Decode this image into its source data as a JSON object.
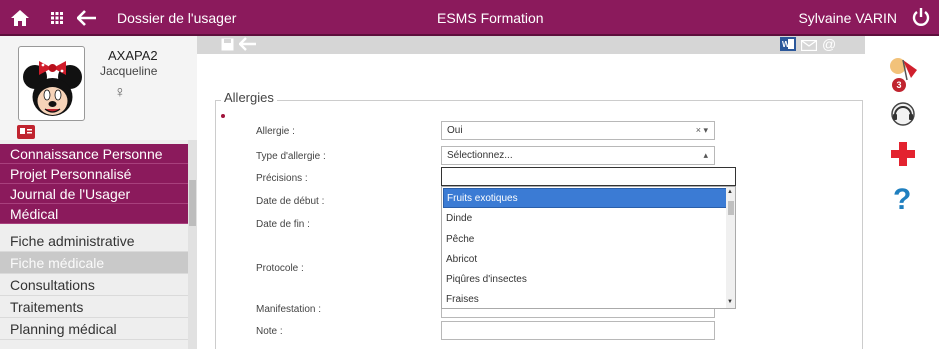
{
  "topbar": {
    "home_icon": "home-icon",
    "grid_icon": "grid-icon",
    "back_icon": "back-arrow-icon",
    "breadcrumb": "Dossier de l'usager",
    "center_title": "ESMS Formation",
    "user_name": "Sylvaine VARIN",
    "power_icon": "power-icon",
    "bg_color": "#8b1a5c"
  },
  "profile": {
    "code": "AXAPA2",
    "first_name": "Jacqueline",
    "gender_symbol": "♀",
    "avatar_icon": "minnie-avatar",
    "id_card_icon": "id-card-icon"
  },
  "menu_purple": {
    "items": [
      {
        "label": "Connaissance Personne"
      },
      {
        "label": "Projet Personnalisé"
      },
      {
        "label": "Journal de l'Usager"
      },
      {
        "label": "Médical"
      }
    ]
  },
  "menu_grey": {
    "items": [
      {
        "label": "Fiche administrative",
        "active": false
      },
      {
        "label": "Fiche médicale",
        "active": true
      },
      {
        "label": "Consultations",
        "active": false
      },
      {
        "label": "Traitements",
        "active": false
      },
      {
        "label": "Planning médical",
        "active": false
      }
    ]
  },
  "toolbar": {
    "save_icon": "save-icon",
    "back_icon": "back-arrow-icon",
    "word_icon": "word-icon",
    "mail_icon": "mail-icon",
    "at_icon": "at-icon"
  },
  "right": {
    "notification_count": "3",
    "icons": [
      "notification-flag-icon",
      "support-headset-icon",
      "medical-cross-icon",
      "help-icon"
    ]
  },
  "form": {
    "legend": "Allergies",
    "fields": {
      "allergie": {
        "label": "Allergie :",
        "value": "Oui"
      },
      "type_allergie": {
        "label": "Type d'allergie :",
        "value": "Sélectionnez..."
      },
      "precisions": {
        "label": "Précisions :",
        "value": ""
      },
      "date_debut": {
        "label": "Date de début :"
      },
      "date_fin": {
        "label": "Date de fin :"
      },
      "protocole": {
        "label": "Protocole :"
      },
      "manifestation": {
        "label": "Manifestation :"
      },
      "note": {
        "label": "Note :",
        "value": ""
      }
    },
    "dropdown_options": [
      {
        "label": "Fruits exotiques",
        "selected": true
      },
      {
        "label": "Dinde",
        "selected": false
      },
      {
        "label": "Pêche",
        "selected": false
      },
      {
        "label": "Abricot",
        "selected": false
      },
      {
        "label": "Piqûres d'insectes",
        "selected": false
      },
      {
        "label": "Fraises",
        "selected": false
      }
    ]
  }
}
